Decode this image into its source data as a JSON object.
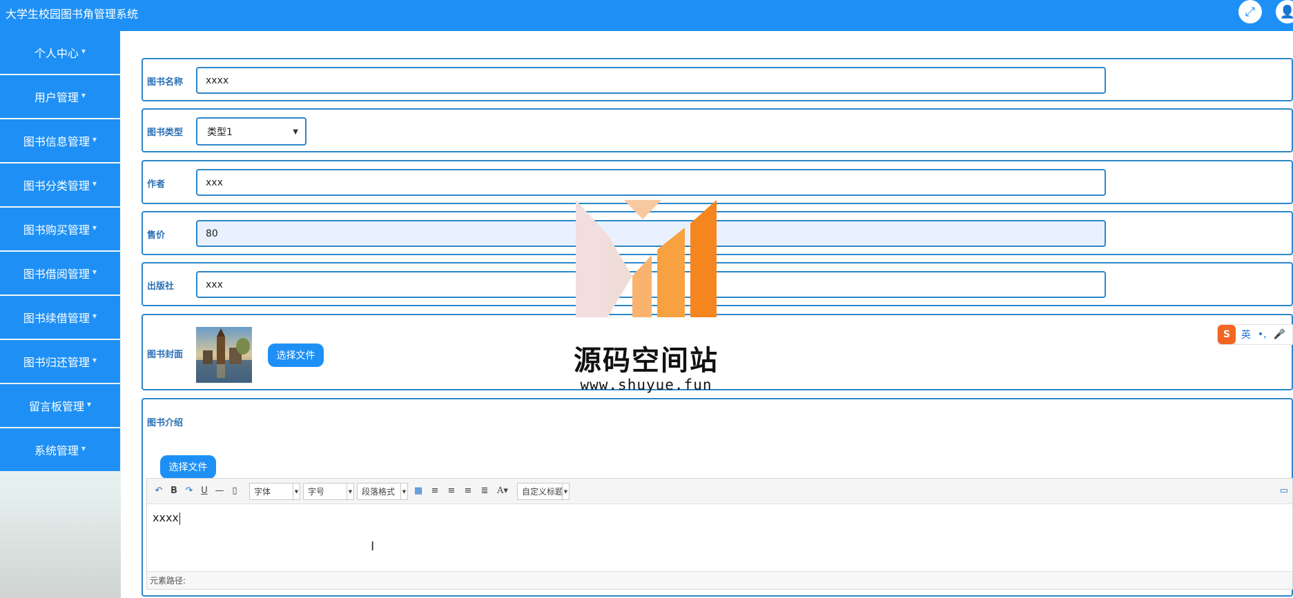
{
  "app": {
    "title": "大学生校园图书角管理系统"
  },
  "header_icons": {
    "expand": "expand-icon",
    "user": "user-icon"
  },
  "sidebar": {
    "items": [
      {
        "label": "个人中心"
      },
      {
        "label": "用户管理"
      },
      {
        "label": "图书信息管理"
      },
      {
        "label": "图书分类管理"
      },
      {
        "label": "图书购买管理"
      },
      {
        "label": "图书借阅管理"
      },
      {
        "label": "图书续借管理"
      },
      {
        "label": "图书归还管理"
      },
      {
        "label": "留言板管理"
      },
      {
        "label": "系统管理"
      }
    ]
  },
  "form": {
    "book_name": {
      "label": "图书名称",
      "value": "xxxx"
    },
    "book_type": {
      "label": "图书类型",
      "value": "类型1"
    },
    "author": {
      "label": "作者",
      "value": "xxx"
    },
    "price": {
      "label": "售价",
      "value": "80"
    },
    "publisher": {
      "label": "出版社",
      "value": "xxx"
    },
    "cover": {
      "label": "图书封面",
      "button": "选择文件"
    },
    "intro": {
      "label": "图书介绍",
      "button": "选择文件"
    }
  },
  "editor": {
    "font_combo": "字体",
    "size_combo": "字号",
    "paragraph_combo": "段落格式",
    "custom_title_combo": "自定义标题",
    "content": "xxxx",
    "status_label": "元素路径:"
  },
  "watermark": {
    "name": "源码空间站",
    "url": "www.shuyue.fun"
  },
  "ime": {
    "logo": "S",
    "lang": "英",
    "punct": "•,",
    "mic": "🎤"
  },
  "colors": {
    "primary": "#1e90f5",
    "border": "#2a86c8",
    "label": "#2a6fb5",
    "watermark_orange": "#f5861f"
  }
}
